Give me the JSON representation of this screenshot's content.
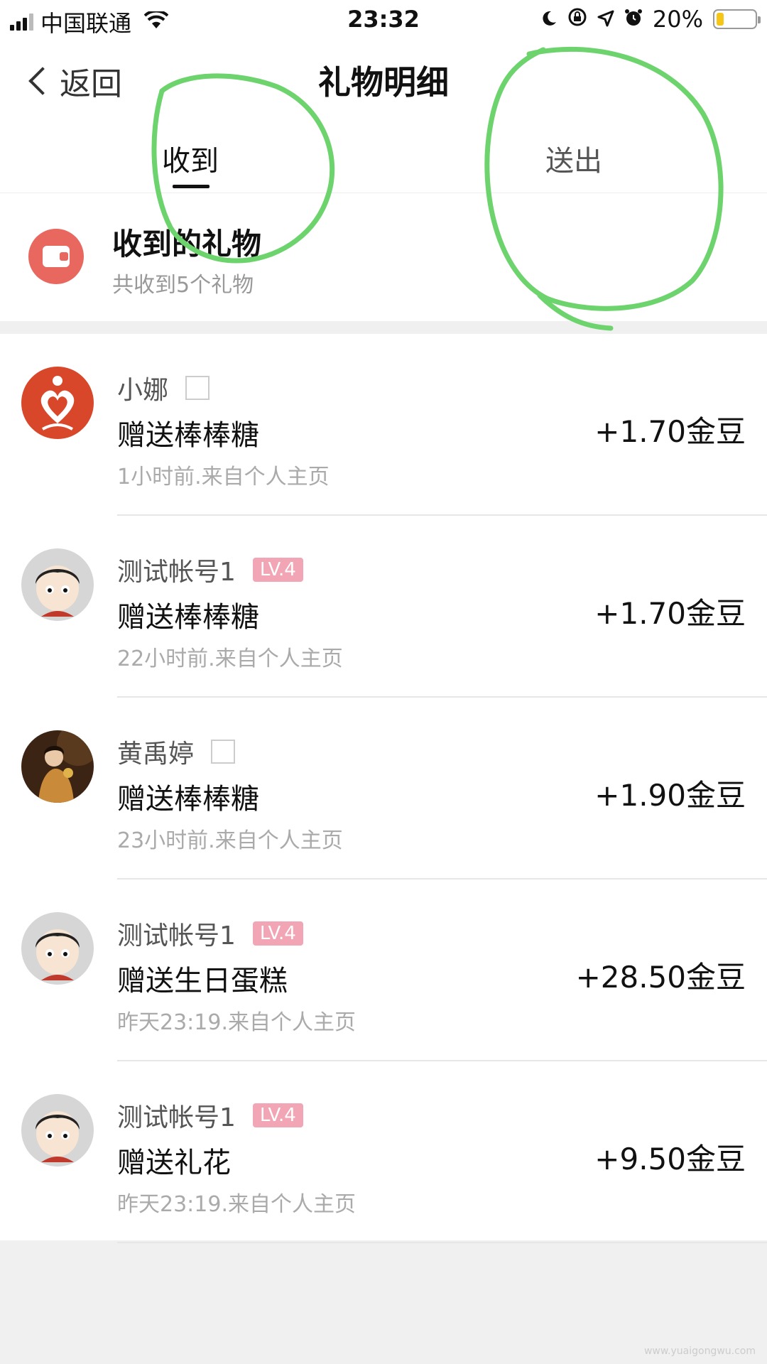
{
  "status_bar": {
    "carrier": "中国联通",
    "time": "23:32",
    "battery_percent": "20%",
    "battery_level": 0.2,
    "icons": [
      "signal-icon",
      "wifi-icon",
      "moon-icon",
      "rotation-lock-icon",
      "location-icon",
      "alarm-icon",
      "battery-icon"
    ]
  },
  "nav": {
    "back_label": "返回",
    "title": "礼物明细"
  },
  "tabs": [
    {
      "label": "收到",
      "active": true
    },
    {
      "label": "送出",
      "active": false
    }
  ],
  "summary": {
    "title": "收到的礼物",
    "subtitle": "共收到5个礼物"
  },
  "records": [
    {
      "name": "小娜",
      "badge": "",
      "gift": "赠送棒棒糖",
      "time": "1小时前.来自个人主页",
      "amount": "+1.70金豆"
    },
    {
      "name": "测试帐号1",
      "badge": "LV.4",
      "gift": "赠送棒棒糖",
      "time": "22小时前.来自个人主页",
      "amount": "+1.70金豆"
    },
    {
      "name": "黄禹婷",
      "badge": "",
      "gift": "赠送棒棒糖",
      "time": "23小时前.来自个人主页",
      "amount": "+1.90金豆"
    },
    {
      "name": "测试帐号1",
      "badge": "LV.4",
      "gift": "赠送生日蛋糕",
      "time": "昨天23:19.来自个人主页",
      "amount": "+28.50金豆"
    },
    {
      "name": "测试帐号1",
      "badge": "LV.4",
      "gift": "赠送礼花",
      "time": "昨天23:19.来自个人主页",
      "amount": "+9.50金豆"
    }
  ],
  "colors": {
    "accent_wallet": "#e8675e",
    "level_badge": "#f2a5b4",
    "annotation_green": "#6dd36d"
  },
  "watermark": "www.yuaigongwu.com"
}
